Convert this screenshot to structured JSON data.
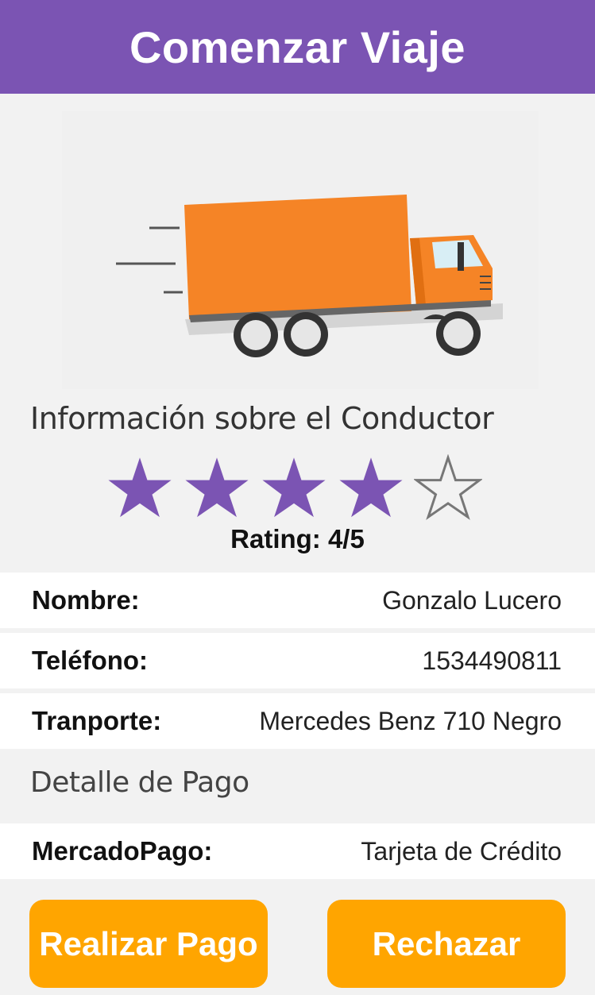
{
  "header": {
    "title": "Comenzar Viaje"
  },
  "hero": {
    "icon": "delivery-truck-icon",
    "truck_color": "#f58426",
    "accent_color": "#7b54b3"
  },
  "driver": {
    "heading": "Información sobre el Conductor",
    "rating_value": 4,
    "rating_max": 5,
    "rating_text": "Rating: 4/5",
    "fields": [
      {
        "label": "Nombre:",
        "value": "Gonzalo Lucero"
      },
      {
        "label": "Teléfono:",
        "value": "1534490811"
      },
      {
        "label": "Tranporte:",
        "value": "Mercedes Benz 710 Negro"
      }
    ]
  },
  "payment": {
    "heading": "Detalle de Pago",
    "method_label": "MercadoPago:",
    "method_value": "Tarjeta de Crédito"
  },
  "actions": {
    "pay_label": "Realizar Pago",
    "reject_label": "Rechazar",
    "button_color": "#ffa500"
  }
}
